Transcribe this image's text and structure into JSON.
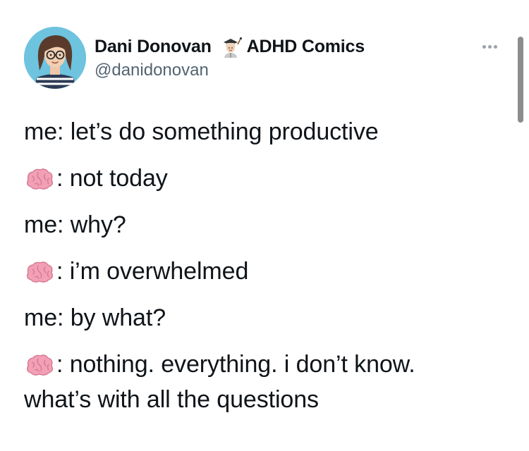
{
  "author": {
    "display_name": "Dani Donovan",
    "affiliation": "ADHD Comics",
    "handle": "@danidonovan",
    "avatar_icon": "cartoon-avatar",
    "badge_icon": "scientist-emoji",
    "more_icon": "more-dots-icon"
  },
  "tweet": {
    "lines": [
      {
        "speaker": "text",
        "text": "me: let’s do something productive"
      },
      {
        "speaker": "brain-emoji",
        "text": ": not today"
      },
      {
        "speaker": "text",
        "text": "me: why?"
      },
      {
        "speaker": "brain-emoji",
        "text": ": i’m overwhelmed"
      },
      {
        "speaker": "text",
        "text": "me: by what?"
      },
      {
        "speaker": "brain-emoji",
        "text": ": nothing. everything. i don’t know."
      },
      {
        "speaker": "text",
        "text": "what’s with all the questions"
      }
    ]
  },
  "colors": {
    "text": "#0f1419",
    "secondary_text": "#536471",
    "avatar_bg": "#6ec3de",
    "brain": "#f2a0b5"
  }
}
